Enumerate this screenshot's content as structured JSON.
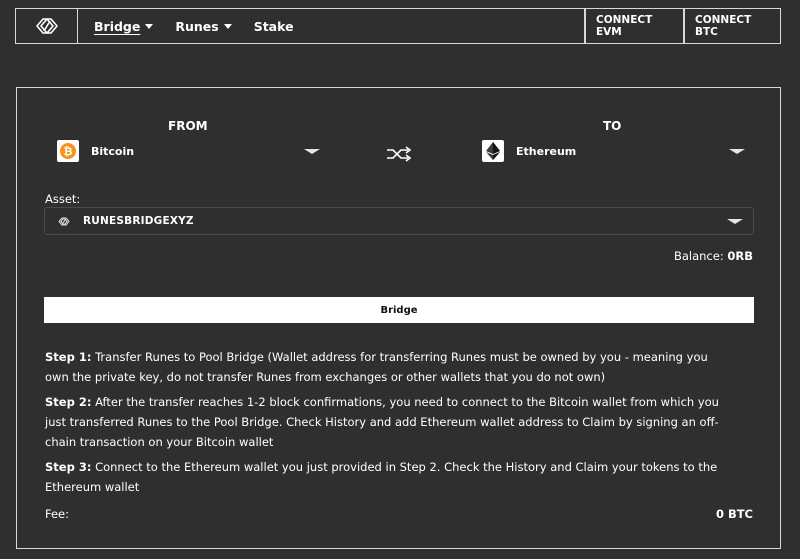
{
  "nav": {
    "logo_icon": "runesbridge-logo-icon",
    "items": [
      {
        "label": "Bridge",
        "has_dropdown": true,
        "active": true
      },
      {
        "label": "Runes",
        "has_dropdown": true,
        "active": false
      },
      {
        "label": "Stake",
        "has_dropdown": false,
        "active": false
      }
    ],
    "connect_evm": "CONNECT EVM",
    "connect_btc": "CONNECT BTC"
  },
  "bridge": {
    "from_title": "FROM",
    "to_title": "TO",
    "from_chain": {
      "name": "Bitcoin",
      "icon": "bitcoin-icon",
      "color": "#f7931a"
    },
    "to_chain": {
      "name": "Ethereum",
      "icon": "ethereum-icon",
      "color": "#3c3c3d"
    },
    "swap_icon": "shuffle-icon",
    "asset_label": "Asset:",
    "asset_value": "RUNESBRIDGEXYZ",
    "balance_label": "Balance:",
    "balance_value": "0RB",
    "bridge_button": "Bridge",
    "steps": [
      {
        "title": "Step 1:",
        "text": "Transfer Runes to Pool Bridge (Wallet address for transferring Runes must be owned by you - meaning you own the private key, do not transfer Runes from exchanges or other wallets that you do not own)"
      },
      {
        "title": "Step 2:",
        "text": "After the transfer reaches 1-2 block confirmations, you need to connect to the Bitcoin wallet from which you just transferred Runes to the Pool Bridge. Check History and add Ethereum wallet address to Claim by signing an off-chain transaction on your Bitcoin wallet"
      },
      {
        "title": "Step 3:",
        "text": "Connect to the Ethereum wallet you just provided in Step 2. Check the History and Claim your tokens to the Ethereum wallet"
      }
    ],
    "fee_label": "Fee:",
    "fee_value": "0 BTC"
  },
  "colors": {
    "background": "#2f2f30",
    "border": "#d8d8d8",
    "text": "#ffffff",
    "button_bg": "#ffffff"
  }
}
